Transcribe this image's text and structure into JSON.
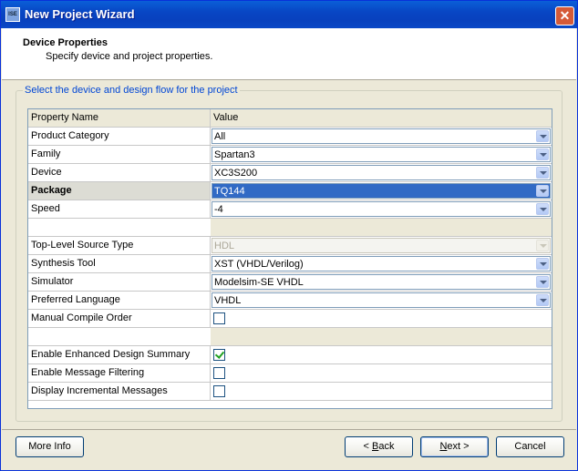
{
  "window": {
    "title": "New Project Wizard",
    "app_icon_text": "ISE",
    "close_label": "✕"
  },
  "header": {
    "title": "Device Properties",
    "subtitle": "Specify device and project properties."
  },
  "group": {
    "legend": "Select the device and design flow for the project"
  },
  "table": {
    "col_name": "Property Name",
    "col_value": "Value",
    "rows": [
      {
        "name": "Product Category",
        "value": "All"
      },
      {
        "name": "Family",
        "value": "Spartan3"
      },
      {
        "name": "Device",
        "value": "XC3S200"
      },
      {
        "name": "Package",
        "value": "TQ144"
      },
      {
        "name": "Speed",
        "value": "-4"
      },
      {
        "name": "Top-Level Source Type",
        "value": "HDL"
      },
      {
        "name": "Synthesis Tool",
        "value": "XST (VHDL/Verilog)"
      },
      {
        "name": "Simulator",
        "value": "Modelsim-SE VHDL"
      },
      {
        "name": "Preferred Language",
        "value": "VHDL"
      },
      {
        "name": "Manual Compile Order",
        "checked": false
      },
      {
        "name": "Enable Enhanced Design Summary",
        "checked": true
      },
      {
        "name": "Enable Message Filtering",
        "checked": false
      },
      {
        "name": "Display Incremental Messages",
        "checked": false
      }
    ]
  },
  "buttons": {
    "more_info": "More Info",
    "back_prefix": "< ",
    "back_mnemonic": "B",
    "back_rest": "ack",
    "next_mnemonic": "N",
    "next_rest": "ext >",
    "cancel": "Cancel"
  },
  "colors": {
    "titlebar": "#0a5fd8",
    "selection": "#316ac5",
    "legend_text": "#0046d5"
  }
}
